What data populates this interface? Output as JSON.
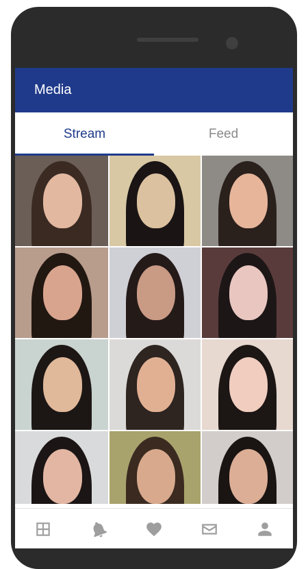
{
  "appbar": {
    "title": "Media"
  },
  "tabs": [
    {
      "label": "Stream",
      "active": true
    },
    {
      "label": "Feed",
      "active": false
    }
  ],
  "photos": [
    {
      "bg": "#6b5e57",
      "hair": "#3a2a22",
      "skin": "#e3b8a0"
    },
    {
      "bg": "#d8c8a4",
      "hair": "#1a1514",
      "skin": "#dcc1a0"
    },
    {
      "bg": "#8e8a86",
      "hair": "#2a201c",
      "skin": "#e6b59a"
    },
    {
      "bg": "#b89c8c",
      "hair": "#221812",
      "skin": "#d9a48e"
    },
    {
      "bg": "#cfcfd6",
      "hair": "#241a18",
      "skin": "#c99a84"
    },
    {
      "bg": "#5a3b3b",
      "hair": "#1d1616",
      "skin": "#e9c6c0"
    },
    {
      "bg": "#c9d3cf",
      "hair": "#1c1715",
      "skin": "#e0b89a"
    },
    {
      "bg": "#dcdad8",
      "hair": "#2e2420",
      "skin": "#e1b093"
    },
    {
      "bg": "#e7d8d0",
      "hair": "#1c1614",
      "skin": "#f0cdbf"
    },
    {
      "bg": "#d9dadb",
      "hair": "#1b1515",
      "skin": "#e2b6a3"
    },
    {
      "bg": "#a8a36c",
      "hair": "#3a2a20",
      "skin": "#d8a98c"
    },
    {
      "bg": "#d2cdca",
      "hair": "#1a1412",
      "skin": "#dcae96"
    }
  ],
  "bottom_nav": [
    {
      "icon": "grid-icon"
    },
    {
      "icon": "bell-icon"
    },
    {
      "icon": "heart-icon"
    },
    {
      "icon": "mail-icon"
    },
    {
      "icon": "person-icon"
    }
  ],
  "colors": {
    "primary": "#1f3a8a",
    "inactive_tab": "#8a8a8a",
    "nav_icon": "#9e9e9e"
  }
}
